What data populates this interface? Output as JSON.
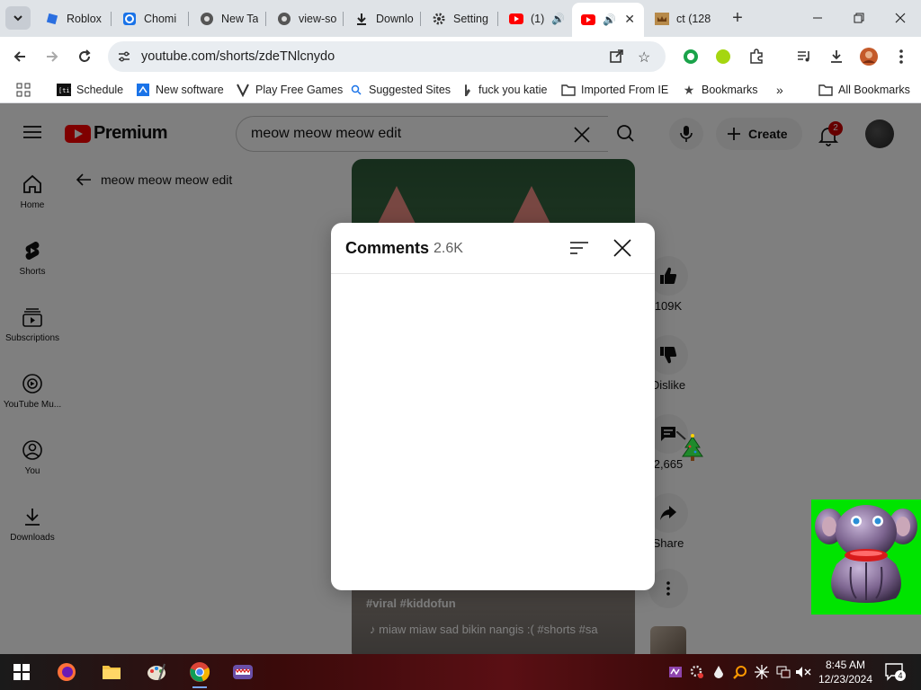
{
  "browser": {
    "tabs": [
      {
        "title": "Roblox",
        "favicon": "roblox-icon"
      },
      {
        "title": "Chomi",
        "favicon": "chomi-icon"
      },
      {
        "title": "New Ta",
        "favicon": "chrome-icon"
      },
      {
        "title": "view-so",
        "favicon": "chrome-icon"
      },
      {
        "title": "Downlo",
        "favicon": "download-icon"
      },
      {
        "title": "Setting",
        "favicon": "gear-icon"
      },
      {
        "title": "(1)",
        "favicon": "youtube-icon"
      },
      {
        "title": "",
        "favicon": "youtube-icon",
        "active": true
      },
      {
        "title": "ct (128",
        "favicon": "crown-icon"
      }
    ],
    "url": "youtube.com/shorts/zdeTNlcnydo"
  },
  "bookmarks": [
    {
      "label": "Schedule",
      "icon": "schedule-icon"
    },
    {
      "label": "New software",
      "icon": "software-icon"
    },
    {
      "label": "Play Free Games",
      "icon": "games-icon"
    },
    {
      "label": "Suggested Sites",
      "icon": "suggested-icon"
    },
    {
      "label": "fuck you katie",
      "icon": "hand-icon"
    },
    {
      "label": "Imported From IE",
      "icon": "folder-icon"
    },
    {
      "label": "Bookmarks",
      "icon": "star-icon"
    },
    {
      "label": "All Bookmarks",
      "icon": "folder-icon"
    }
  ],
  "youtube": {
    "logo_text": "Premium",
    "search_query": "meow meow meow edit",
    "create_label": "Create",
    "notification_count": "2",
    "guide": [
      {
        "label": "Home",
        "icon": "home-icon"
      },
      {
        "label": "Shorts",
        "icon": "shorts-icon"
      },
      {
        "label": "Subscriptions",
        "icon": "subscriptions-icon"
      },
      {
        "label": "YouTube Mu...",
        "icon": "youtube-music-icon"
      },
      {
        "label": "You",
        "icon": "you-icon"
      },
      {
        "label": "Downloads",
        "icon": "downloads-icon"
      }
    ],
    "back_label": "meow meow meow edit",
    "video_caption": "#viral #kiddofun",
    "video_sound": "♪ miaw miaw sad bikin nangis :( #shorts #sa",
    "actions": {
      "like_count": "109K",
      "dislike_label": "Dislike",
      "comment_count": "2,665",
      "share_label": "Share"
    }
  },
  "comments_modal": {
    "title": "Comments",
    "count": "2.6K"
  },
  "taskbar": {
    "time": "8:45 AM",
    "date": "12/23/2024",
    "notification_count": "4"
  },
  "colors": {
    "youtube_red": "#ff0000",
    "green_screen": "#00e400"
  }
}
